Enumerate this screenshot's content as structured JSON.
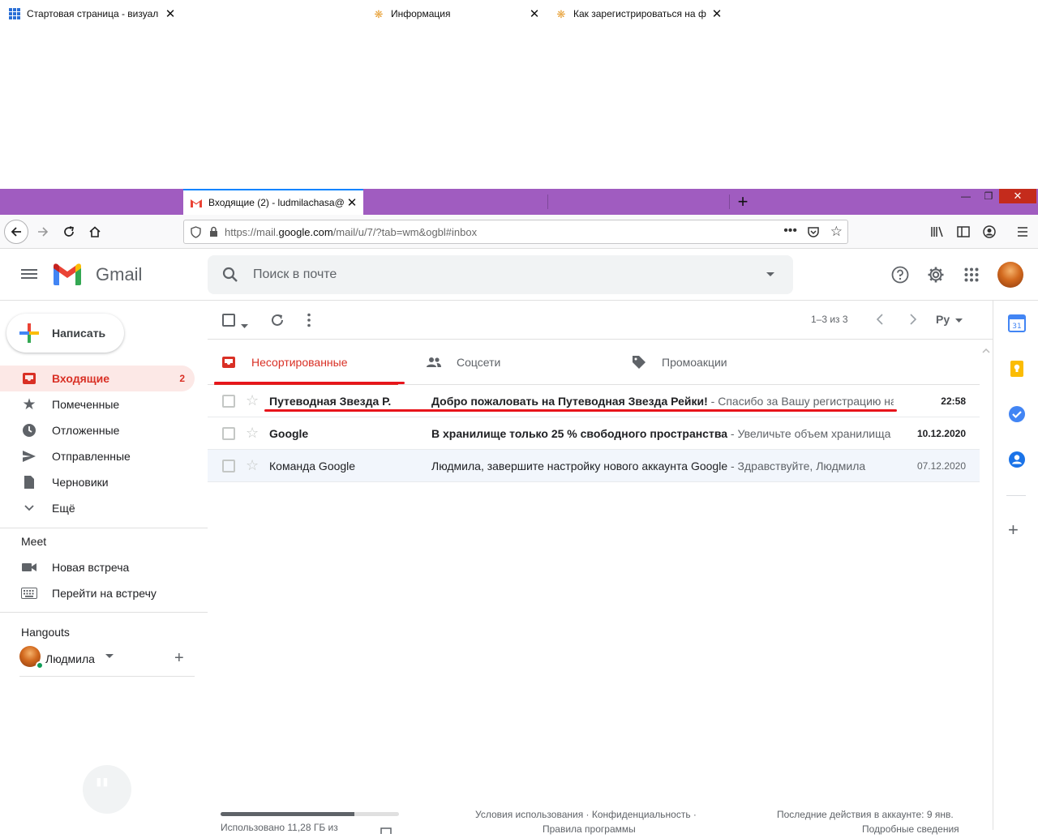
{
  "browser": {
    "tabs": [
      {
        "title": "Стартовая страница - визуал",
        "active": false
      },
      {
        "title": "Входящие (2) - ludmilachasa@",
        "active": true
      },
      {
        "title": "Информация",
        "active": false
      },
      {
        "title": "Как зарегистрироваться на ф",
        "active": false
      }
    ],
    "url_prefix": "https://mail.",
    "url_domain": "google.com",
    "url_suffix": "/mail/u/7/?tab=wm&ogbl#inbox"
  },
  "gmail": {
    "brand": "Gmail",
    "search_placeholder": "Поиск в почте",
    "compose_label": "Написать",
    "nav": [
      {
        "label": "Входящие",
        "icon": "inbox-icon",
        "count": "2",
        "active": true
      },
      {
        "label": "Помеченные",
        "icon": "star-icon",
        "count": "",
        "active": false
      },
      {
        "label": "Отложенные",
        "icon": "clock-icon",
        "count": "",
        "active": false
      },
      {
        "label": "Отправленные",
        "icon": "send-icon",
        "count": "",
        "active": false
      },
      {
        "label": "Черновики",
        "icon": "draft-icon",
        "count": "",
        "active": false
      },
      {
        "label": "Ещё",
        "icon": "chevron-down-icon",
        "count": "",
        "active": false
      }
    ],
    "meet": {
      "title": "Meet",
      "new_meeting": "Новая встреча",
      "join_meeting": "Перейти на встречу"
    },
    "hangouts": {
      "title": "Hangouts",
      "user": "Людмила"
    },
    "pagination": "1–3 из 3",
    "lang": "Ру",
    "tabs": [
      {
        "label": "Несортированные",
        "active": true
      },
      {
        "label": "Соцсети",
        "active": false
      },
      {
        "label": "Промоакции",
        "active": false
      }
    ],
    "emails": [
      {
        "sender": "Путеводная Звезда Р.",
        "subject": "Добро пожаловать на Путеводная Звезда Рейки!",
        "snippet": " - Спасибо за Вашу регистрацию на сайте Путеводная Звезда Рейки",
        "date": "22:58",
        "unread": true
      },
      {
        "sender": "Google",
        "subject": "В хранилище только 25 % свободного пространства",
        "snippet": " - Увеличьте объем хранилища",
        "date": "10.12.2020",
        "unread": true
      },
      {
        "sender": "Команда Google",
        "subject": "Людмила, завершите настройку нового аккаунта Google",
        "snippet": " - Здравствуйте, Людмила",
        "date": "07.12.2020",
        "unread": false
      }
    ],
    "footer": {
      "storage": "Использовано 11,28 ГБ из",
      "storage_fraction": 0.75,
      "terms": "Условия использования · Конфиденциальность ·",
      "program": "Правила программы",
      "activity": "Последние действия в аккаунте: 9 янв.",
      "details": "Подробные сведения"
    },
    "colors": {
      "accent": "#d93025",
      "tabstrip": "#a05cc0"
    }
  }
}
